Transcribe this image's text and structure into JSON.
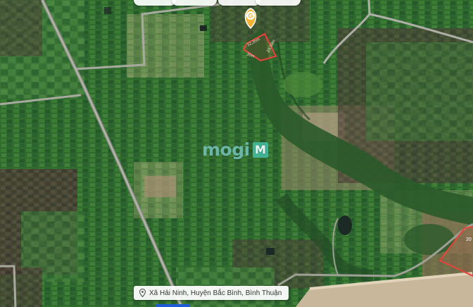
{
  "map": {
    "watermark_text": "mogi",
    "watermark_badge": "M",
    "location_text": "Xã Hải Ninh, Huyện Bắc Bình, Bình Thuận",
    "location_icon": "map-pin-icon",
    "marker_badge": "G",
    "marker_icon": "location-marker-icon",
    "dimension_labels": [
      "32,35m",
      "29,39m",
      "30m"
    ],
    "edge_plot_label": "20",
    "plot_outline_color": "#e8433a",
    "marker_color": "#f2b233"
  }
}
